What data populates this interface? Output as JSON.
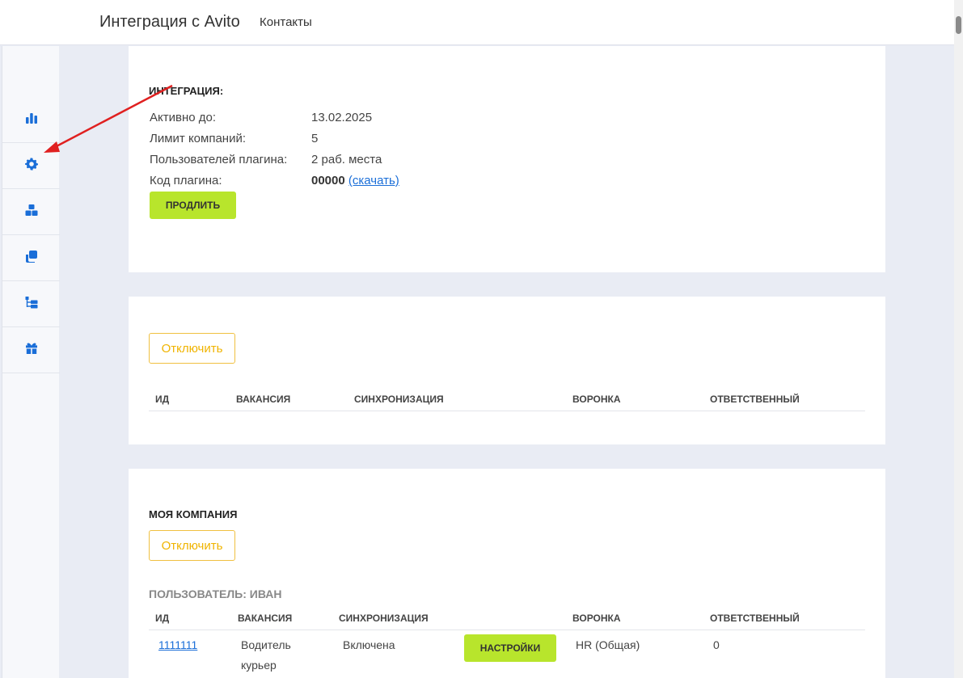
{
  "header": {
    "app_title": "Интеграция с Avito",
    "nav_contacts": "Контакты"
  },
  "sidebar": {
    "items": [
      {
        "icon": "bar-chart-icon"
      },
      {
        "icon": "gear-icon"
      },
      {
        "icon": "boxes-icon"
      },
      {
        "icon": "copy-icon"
      },
      {
        "icon": "tree-structure-icon"
      },
      {
        "icon": "gift-icon"
      }
    ],
    "accent_color": "#1a6ed8"
  },
  "integration": {
    "title": "ИНТЕГРАЦИЯ:",
    "rows": [
      {
        "label": "Активно до:",
        "value": "13.02.2025"
      },
      {
        "label": "Лимит компаний:",
        "value": "5"
      },
      {
        "label": "Пользователей плагина:",
        "value": "2 раб. места"
      }
    ],
    "plugin_code_label": "Код плагина:",
    "plugin_code": "00000",
    "download_link": "(скачать)",
    "extend_button": "ПРОДЛИТЬ"
  },
  "section2": {
    "disconnect_button": "Отключить",
    "columns": [
      "ИД",
      "ВАКАНСИЯ",
      "СИНХРОНИЗАЦИЯ",
      "ВОРОНКА",
      "ОТВЕТСТВЕННЫЙ"
    ]
  },
  "company": {
    "title": "МОЯ КОМПАНИЯ",
    "disconnect_button": "Отключить",
    "user_title": "ПОЛЬЗОВАТЕЛЬ: ИВАН",
    "columns": [
      "ИД",
      "ВАКАНСИЯ",
      "СИНХРОНИЗАЦИЯ",
      "ВОРОНКА",
      "ОТВЕТСТВЕННЫЙ"
    ],
    "rows": [
      {
        "id": "1111111",
        "vacancy_line1": "Водитель",
        "vacancy_line2": "курьер",
        "sync": "Включена",
        "settings_button": "НАСТРОЙКИ",
        "funnel": "HR (Общая)",
        "responsible": "0"
      }
    ]
  },
  "colors": {
    "button_green": "#b8e52c",
    "button_outline": "#f0b400",
    "link": "#1a6ed8",
    "annotation_arrow": "#e02020"
  }
}
